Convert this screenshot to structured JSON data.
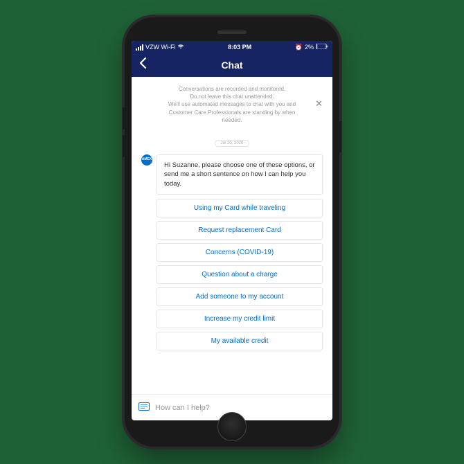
{
  "status_bar": {
    "carrier": "VZW Wi-Fi",
    "time": "8:03 PM",
    "battery_percent": "2%",
    "alarm_glyph": "⏰"
  },
  "header": {
    "title": "Chat"
  },
  "notice": {
    "line1": "Conversations are recorded and monitored.",
    "line2": "Do not leave this chat unattended.",
    "line3": "We'll use automated messages to chat with you and",
    "line4": "Customer Care Professionals are standing by when",
    "line5": "needed.",
    "close_glyph": "✕"
  },
  "date": "Jul 20, 2020",
  "avatar_label": "AMEX",
  "message": "Hi Suzanne, please choose one of these options, or send me a short sentence on how I can help you today.",
  "options": [
    "Using my Card while traveling",
    "Request replacement Card",
    "Concerns (COVID-19)",
    "Question about a charge",
    "Add someone to my account",
    "Increase my credit limit",
    "My available credit"
  ],
  "input": {
    "placeholder": "How can I help?"
  }
}
